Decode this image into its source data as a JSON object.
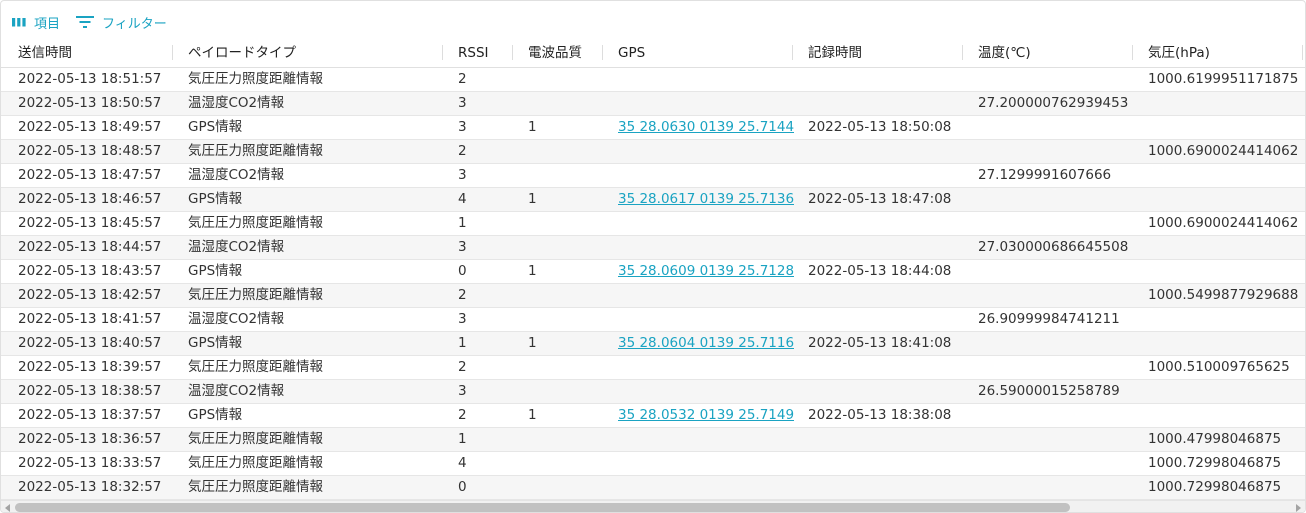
{
  "toolbar": {
    "columns_label": "項目",
    "columns_icon": "columns-icon",
    "filter_label": "フィルター",
    "filter_icon": "filter-icon",
    "accent_color": "#1aa3c2"
  },
  "columns": [
    {
      "key": "sent_time",
      "label": "送信時間"
    },
    {
      "key": "payload_type",
      "label": "ペイロードタイプ"
    },
    {
      "key": "rssi",
      "label": "RSSI"
    },
    {
      "key": "signal_quality",
      "label": "電波品質"
    },
    {
      "key": "gps",
      "label": "GPS"
    },
    {
      "key": "recorded_time",
      "label": "記録時間"
    },
    {
      "key": "temperature",
      "label": "温度(℃)"
    },
    {
      "key": "pressure",
      "label": "気圧(hPa)"
    }
  ],
  "rows": [
    {
      "sent_time": "2022-05-13 18:51:57",
      "payload_type": "気圧圧力照度距離情報",
      "rssi": "2",
      "signal_quality": "",
      "gps": "",
      "recorded_time": "",
      "temperature": "",
      "pressure": "1000.6199951171875"
    },
    {
      "sent_time": "2022-05-13 18:50:57",
      "payload_type": "温湿度CO2情報",
      "rssi": "3",
      "signal_quality": "",
      "gps": "",
      "recorded_time": "",
      "temperature": "27.200000762939453",
      "pressure": ""
    },
    {
      "sent_time": "2022-05-13 18:49:57",
      "payload_type": "GPS情報",
      "rssi": "3",
      "signal_quality": "1",
      "gps": "35 28.0630 0139 25.7144",
      "recorded_time": "2022-05-13 18:50:08",
      "temperature": "",
      "pressure": ""
    },
    {
      "sent_time": "2022-05-13 18:48:57",
      "payload_type": "気圧圧力照度距離情報",
      "rssi": "2",
      "signal_quality": "",
      "gps": "",
      "recorded_time": "",
      "temperature": "",
      "pressure": "1000.6900024414062"
    },
    {
      "sent_time": "2022-05-13 18:47:57",
      "payload_type": "温湿度CO2情報",
      "rssi": "3",
      "signal_quality": "",
      "gps": "",
      "recorded_time": "",
      "temperature": "27.1299991607666",
      "pressure": ""
    },
    {
      "sent_time": "2022-05-13 18:46:57",
      "payload_type": "GPS情報",
      "rssi": "4",
      "signal_quality": "1",
      "gps": "35 28.0617 0139 25.7136",
      "recorded_time": "2022-05-13 18:47:08",
      "temperature": "",
      "pressure": ""
    },
    {
      "sent_time": "2022-05-13 18:45:57",
      "payload_type": "気圧圧力照度距離情報",
      "rssi": "1",
      "signal_quality": "",
      "gps": "",
      "recorded_time": "",
      "temperature": "",
      "pressure": "1000.6900024414062"
    },
    {
      "sent_time": "2022-05-13 18:44:57",
      "payload_type": "温湿度CO2情報",
      "rssi": "3",
      "signal_quality": "",
      "gps": "",
      "recorded_time": "",
      "temperature": "27.030000686645508",
      "pressure": ""
    },
    {
      "sent_time": "2022-05-13 18:43:57",
      "payload_type": "GPS情報",
      "rssi": "0",
      "signal_quality": "1",
      "gps": "35 28.0609 0139 25.7128",
      "recorded_time": "2022-05-13 18:44:08",
      "temperature": "",
      "pressure": ""
    },
    {
      "sent_time": "2022-05-13 18:42:57",
      "payload_type": "気圧圧力照度距離情報",
      "rssi": "2",
      "signal_quality": "",
      "gps": "",
      "recorded_time": "",
      "temperature": "",
      "pressure": "1000.5499877929688"
    },
    {
      "sent_time": "2022-05-13 18:41:57",
      "payload_type": "温湿度CO2情報",
      "rssi": "3",
      "signal_quality": "",
      "gps": "",
      "recorded_time": "",
      "temperature": "26.90999984741211",
      "pressure": ""
    },
    {
      "sent_time": "2022-05-13 18:40:57",
      "payload_type": "GPS情報",
      "rssi": "1",
      "signal_quality": "1",
      "gps": "35 28.0604 0139 25.7116",
      "recorded_time": "2022-05-13 18:41:08",
      "temperature": "",
      "pressure": ""
    },
    {
      "sent_time": "2022-05-13 18:39:57",
      "payload_type": "気圧圧力照度距離情報",
      "rssi": "2",
      "signal_quality": "",
      "gps": "",
      "recorded_time": "",
      "temperature": "",
      "pressure": "1000.510009765625"
    },
    {
      "sent_time": "2022-05-13 18:38:57",
      "payload_type": "温湿度CO2情報",
      "rssi": "3",
      "signal_quality": "",
      "gps": "",
      "recorded_time": "",
      "temperature": "26.59000015258789",
      "pressure": ""
    },
    {
      "sent_time": "2022-05-13 18:37:57",
      "payload_type": "GPS情報",
      "rssi": "2",
      "signal_quality": "1",
      "gps": "35 28.0532 0139 25.7149",
      "recorded_time": "2022-05-13 18:38:08",
      "temperature": "",
      "pressure": ""
    },
    {
      "sent_time": "2022-05-13 18:36:57",
      "payload_type": "気圧圧力照度距離情報",
      "rssi": "1",
      "signal_quality": "",
      "gps": "",
      "recorded_time": "",
      "temperature": "",
      "pressure": "1000.47998046875"
    },
    {
      "sent_time": "2022-05-13 18:33:57",
      "payload_type": "気圧圧力照度距離情報",
      "rssi": "4",
      "signal_quality": "",
      "gps": "",
      "recorded_time": "",
      "temperature": "",
      "pressure": "1000.72998046875"
    },
    {
      "sent_time": "2022-05-13 18:32:57",
      "payload_type": "気圧圧力照度距離情報",
      "rssi": "0",
      "signal_quality": "",
      "gps": "",
      "recorded_time": "",
      "temperature": "",
      "pressure": "1000.72998046875"
    }
  ]
}
